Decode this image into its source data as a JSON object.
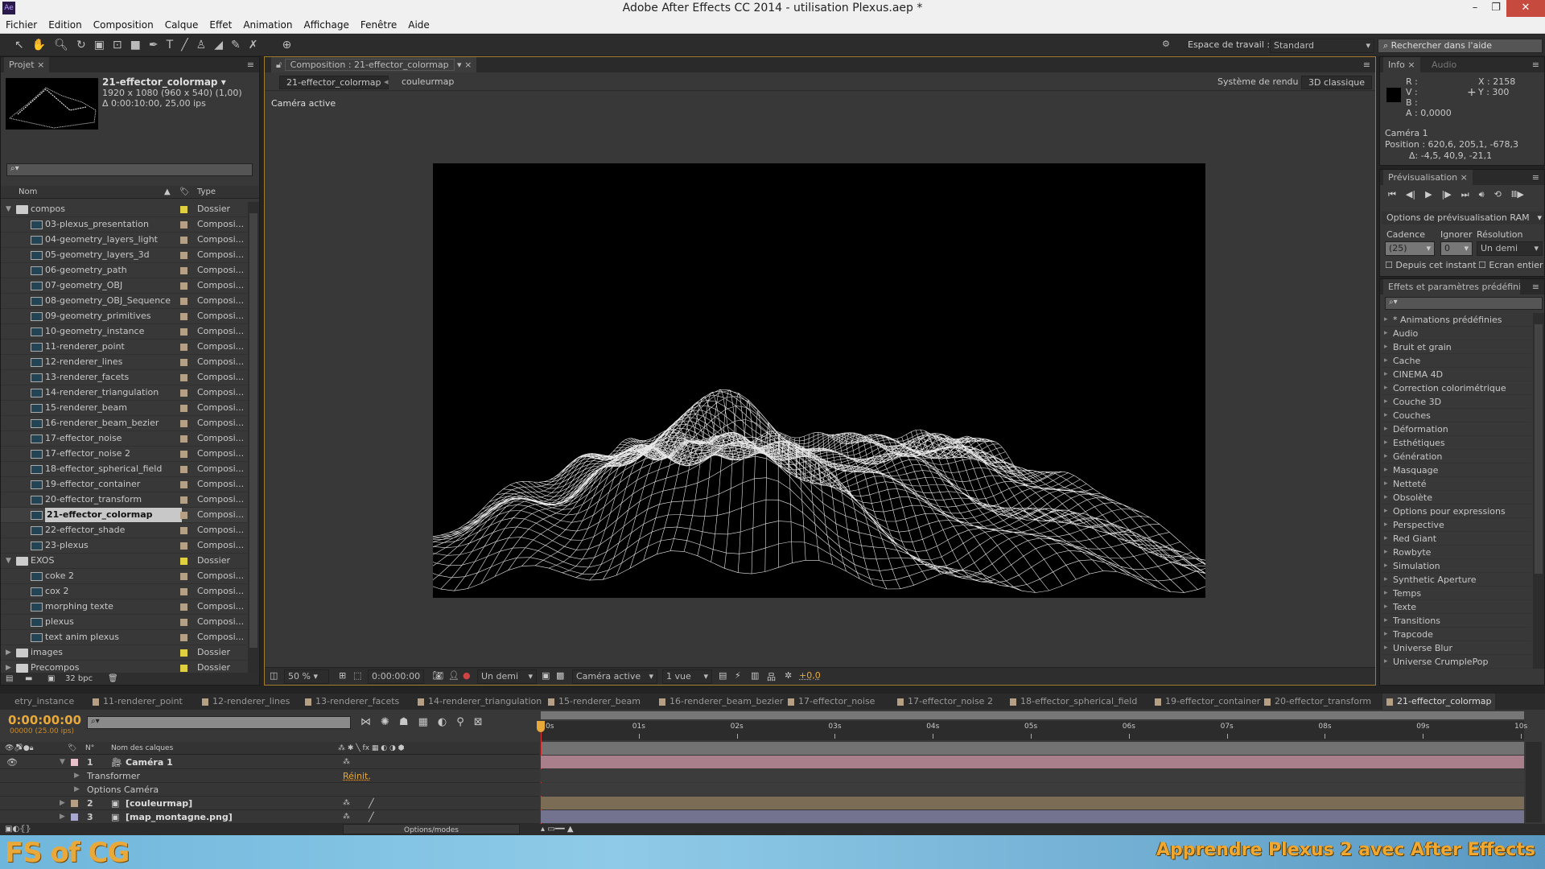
{
  "app": {
    "title": "Adobe After Effects CC 2014 - utilisation Plexus.aep *",
    "logo": "Ae"
  },
  "menu": [
    "Fichier",
    "Edition",
    "Composition",
    "Calque",
    "Effet",
    "Animation",
    "Affichage",
    "Fenêtre",
    "Aide"
  ],
  "workspace": {
    "label": "Espace de travail :",
    "value": "Standard",
    "help_placeholder": "Rechercher dans l'aide"
  },
  "project": {
    "tab": "Projet",
    "comp_name": "21-effector_colormap ▾",
    "comp_size": "1920 x 1080  (960 x 540) (1,00)",
    "comp_duration": "Δ 0:00:10:00, 25,00 ips",
    "col_name": "Nom",
    "col_type": "Type",
    "bpc": "32 bpc",
    "items": [
      {
        "name": "compos",
        "type": "Dossier",
        "kind": "folder",
        "level": 0,
        "open": true
      },
      {
        "name": "03-plexus_presentation",
        "type": "Composi...",
        "kind": "comp",
        "level": 1
      },
      {
        "name": "04-geometry_layers_light",
        "type": "Composi...",
        "kind": "comp",
        "level": 1
      },
      {
        "name": "05-geometry_layers_3d",
        "type": "Composi...",
        "kind": "comp",
        "level": 1
      },
      {
        "name": "06-geometry_path",
        "type": "Composi...",
        "kind": "comp",
        "level": 1
      },
      {
        "name": "07-geometry_OBJ",
        "type": "Composi...",
        "kind": "comp",
        "level": 1
      },
      {
        "name": "08-geometry_OBJ_Sequence",
        "type": "Composi...",
        "kind": "comp",
        "level": 1
      },
      {
        "name": "09-geometry_primitives",
        "type": "Composi...",
        "kind": "comp",
        "level": 1
      },
      {
        "name": "10-geometry_instance",
        "type": "Composi...",
        "kind": "comp",
        "level": 1
      },
      {
        "name": "11-renderer_point",
        "type": "Composi...",
        "kind": "comp",
        "level": 1
      },
      {
        "name": "12-renderer_lines",
        "type": "Composi...",
        "kind": "comp",
        "level": 1
      },
      {
        "name": "13-renderer_facets",
        "type": "Composi...",
        "kind": "comp",
        "level": 1
      },
      {
        "name": "14-renderer_triangulation",
        "type": "Composi...",
        "kind": "comp",
        "level": 1
      },
      {
        "name": "15-renderer_beam",
        "type": "Composi...",
        "kind": "comp",
        "level": 1
      },
      {
        "name": "16-renderer_beam_bezier",
        "type": "Composi...",
        "kind": "comp",
        "level": 1
      },
      {
        "name": "17-effector_noise",
        "type": "Composi...",
        "kind": "comp",
        "level": 1
      },
      {
        "name": "17-effector_noise 2",
        "type": "Composi...",
        "kind": "comp",
        "level": 1
      },
      {
        "name": "18-effector_spherical_field",
        "type": "Composi...",
        "kind": "comp",
        "level": 1
      },
      {
        "name": "19-effector_container",
        "type": "Composi...",
        "kind": "comp",
        "level": 1
      },
      {
        "name": "20-effector_transform",
        "type": "Composi...",
        "kind": "comp",
        "level": 1
      },
      {
        "name": "21-effector_colormap",
        "type": "Composi...",
        "kind": "comp",
        "level": 1,
        "selected": true
      },
      {
        "name": "22-effector_shade",
        "type": "Composi...",
        "kind": "comp",
        "level": 1
      },
      {
        "name": "23-plexus",
        "type": "Composi...",
        "kind": "comp",
        "level": 1
      },
      {
        "name": "EXOS",
        "type": "Dossier",
        "kind": "folder",
        "level": 0,
        "open": true
      },
      {
        "name": "coke 2",
        "type": "Composi...",
        "kind": "comp",
        "level": 1
      },
      {
        "name": "cox 2",
        "type": "Composi...",
        "kind": "comp",
        "level": 1
      },
      {
        "name": "morphing texte",
        "type": "Composi...",
        "kind": "comp",
        "level": 1
      },
      {
        "name": "plexus",
        "type": "Composi...",
        "kind": "comp",
        "level": 1
      },
      {
        "name": "text anim plexus",
        "type": "Composi...",
        "kind": "comp",
        "level": 1
      },
      {
        "name": "images",
        "type": "Dossier",
        "kind": "folder",
        "level": 0,
        "open": false
      },
      {
        "name": "Precompos",
        "type": "Dossier",
        "kind": "folder",
        "level": 0,
        "open": false
      }
    ]
  },
  "composition": {
    "tab": "Composition : 21-effector_colormap",
    "breadcrumb": [
      "21-effector_colormap",
      "couleurmap"
    ],
    "render_label": "Système de rendu :",
    "render_value": "3D  classique",
    "camera_label": "Caméra active",
    "footer": {
      "zoom": "50 %",
      "timecode": "0:00:00:00",
      "resolution": "Un demi",
      "view": "Caméra active",
      "layout": "1 vue",
      "exposure": "+0,0"
    }
  },
  "info": {
    "tab": "Info",
    "tab2": "Audio",
    "r": "R :",
    "v": "V :",
    "b": "B :",
    "a": "A :  0,0000",
    "x": "X : 2158",
    "y": "Y : 300",
    "camera": "Caméra 1",
    "position": "Position : 620,6, 205,1, -678,3",
    "delta": "Δ: -4,5, 40,9, -21,1"
  },
  "preview": {
    "tab": "Prévisualisation",
    "ram": "Options de prévisualisation RAM",
    "cadence_label": "Cadence",
    "ignore_label": "Ignorer",
    "res_label": "Résolution",
    "cadence": "(25)",
    "ignore": "0",
    "res": "Un demi",
    "from_now": "Depuis cet instant",
    "fullscreen": "Ecran entier"
  },
  "effects": {
    "tab": "Effets et paramètres prédéfinis",
    "items": [
      "* Animations prédéfinies",
      "Audio",
      "Bruit et grain",
      "Cache",
      "CINEMA 4D",
      "Correction colorimétrique",
      "Couche 3D",
      "Couches",
      "Déformation",
      "Esthétiques",
      "Génération",
      "Masquage",
      "Netteté",
      "Obsolète",
      "Options pour expressions",
      "Perspective",
      "Red Giant",
      "Rowbyte",
      "Simulation",
      "Synthetic Aperture",
      "Temps",
      "Texte",
      "Transitions",
      "Trapcode",
      "Universe Blur",
      "Universe CrumplePop"
    ]
  },
  "timeline": {
    "tabs": [
      "etry_instance",
      "11-renderer_point",
      "12-renderer_lines",
      "13-renderer_facets",
      "14-renderer_triangulation",
      "15-renderer_beam",
      "16-renderer_beam_bezier",
      "17-effector_noise",
      "17-effector_noise 2",
      "18-effector_spherical_field",
      "19-effector_container",
      "20-effector_transform",
      "21-effector_colormap"
    ],
    "timecode": "0:00:00:00",
    "frames": "00000 (25.00 ips)",
    "col_num": "N°",
    "col_name": "Nom des calques",
    "options_modes": "Options/modes",
    "ruler": [
      "0s",
      "01s",
      "02s",
      "03s",
      "04s",
      "05s",
      "06s",
      "07s",
      "08s",
      "09s",
      "10s"
    ],
    "layers": [
      {
        "num": "1",
        "name": "Caméra 1",
        "color": "#e8c0cc",
        "bar": "#a87f8b",
        "expanded": true
      },
      {
        "sub": "Transformer",
        "value": "Réinit."
      },
      {
        "sub": "Options Caméra"
      },
      {
        "num": "2",
        "name": "[couleurmap]",
        "color": "#b5a085",
        "bar": "#7a6c55"
      },
      {
        "num": "3",
        "name": "[map_montagne.png]",
        "color": "#a7a7d0",
        "bar": "#73738f"
      }
    ]
  },
  "banner": {
    "logo": "FS of CG",
    "slogan": "Apprendre Plexus 2 avec After Effects"
  },
  "colors": {
    "accent": "#e8a93a",
    "panel": "#383838",
    "banner": "#7fbfdf"
  }
}
